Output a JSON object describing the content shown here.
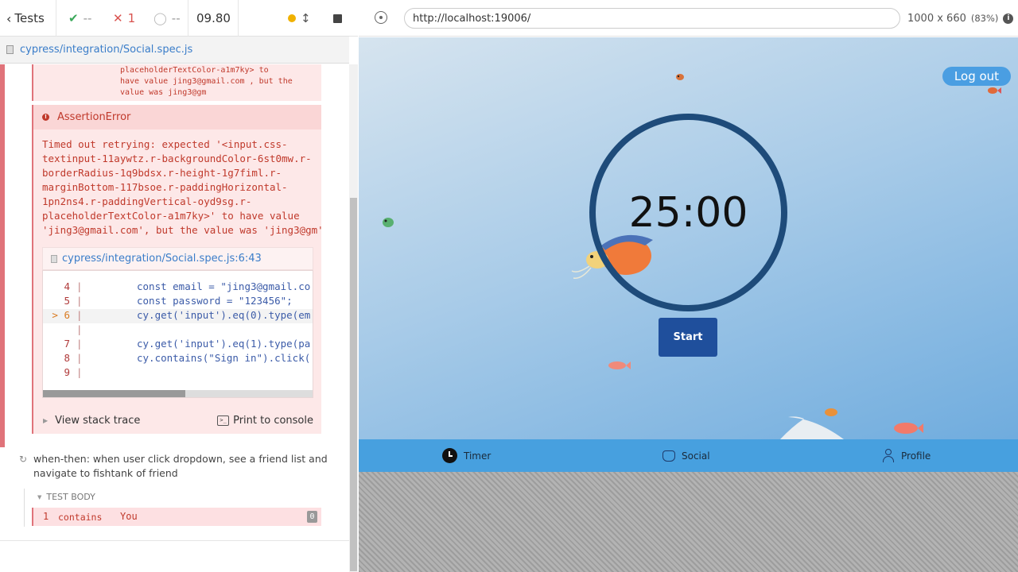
{
  "reporter": {
    "back_label": "Tests",
    "passed": "--",
    "failed": "1",
    "pending": "--",
    "duration": "09.80",
    "spec_path": "cypress/integration/Social.spec.js",
    "prev_error_tail": [
      "placeholderTextColor-a1m7ky>  to",
      "have value  jing3@gmail.com , but the",
      "value was  jing3@gm"
    ],
    "error": {
      "title": "AssertionError",
      "message": [
        "Timed out retrying: expected '<input.css-",
        "textinput-11aywtz.r-backgroundColor-6st0mw.r-",
        "borderRadius-1q9bdsx.r-height-1g7fiml.r-",
        "marginBottom-117bsoe.r-paddingHorizontal-",
        "1pn2ns4.r-paddingVertical-oyd9sg.r-",
        "placeholderTextColor-a1m7ky>' to have value",
        "'jing3@gmail.com', but the value was 'jing3@gm'"
      ],
      "file_link": "cypress/integration/Social.spec.js:6:43",
      "code_lines": [
        {
          "num": "4",
          "code": "const email = \"jing3@gmail.co"
        },
        {
          "num": "5",
          "code": "const password = \"123456\";"
        },
        {
          "num": "> 6",
          "code": "cy.get('input').eq(0).type(em"
        },
        {
          "num": "",
          "code": ""
        },
        {
          "num": "7",
          "code": "cy.get('input').eq(1).type(pa"
        },
        {
          "num": "8",
          "code": "cy.contains(\"Sign in\").click("
        },
        {
          "num": "9",
          "code": ""
        }
      ],
      "stack_trace_label": "View stack trace",
      "print_console_label": "Print to console"
    },
    "next_test": {
      "title_line1": "when-then: when user click dropdown, see a friend list and",
      "title_line2": "navigate to fishtank of friend",
      "body_label": "TEST BODY",
      "cmd_num": "1",
      "cmd_name": "contains",
      "cmd_arg": "You",
      "cmd_count": "0"
    }
  },
  "browser": {
    "url": "http://localhost:19006/",
    "viewport_size": "1000 x 660",
    "zoom": "(83%)"
  },
  "app": {
    "logout_label": "Log out",
    "timer": "25:00",
    "start_label": "Start",
    "tabs": [
      "Timer",
      "Social",
      "Profile"
    ]
  }
}
